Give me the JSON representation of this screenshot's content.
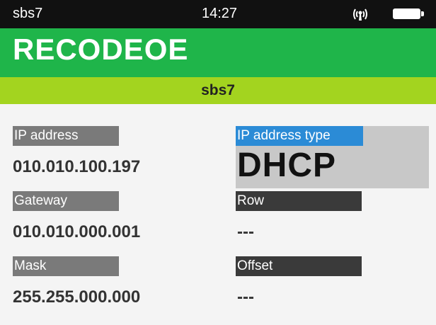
{
  "status_bar": {
    "device_name": "sbs7",
    "time": "14:27",
    "signal_icon": "wireless-signal-icon",
    "battery_icon": "battery-full-icon"
  },
  "header": {
    "title": "RECODEOE"
  },
  "sub_header": {
    "label": "sbs7"
  },
  "fields": {
    "ip_address": {
      "label": "IP address",
      "value": "010.010.100.197"
    },
    "gateway": {
      "label": "Gateway",
      "value": "010.010.000.001"
    },
    "mask": {
      "label": "Mask",
      "value": "255.255.000.000"
    },
    "ip_address_type": {
      "label": "IP address type",
      "value": "DHCP"
    },
    "row": {
      "label": "Row",
      "value": "---"
    },
    "offset": {
      "label": "Offset",
      "value": "---"
    }
  },
  "colors": {
    "status_bar": "#111111",
    "header": "#1fb54a",
    "sub_header": "#a3d41f",
    "label_gray": "#7a7a7a",
    "label_dark": "#3a3a3a",
    "label_selected": "#2b8bd6",
    "selected_box": "#c8c8c8"
  }
}
